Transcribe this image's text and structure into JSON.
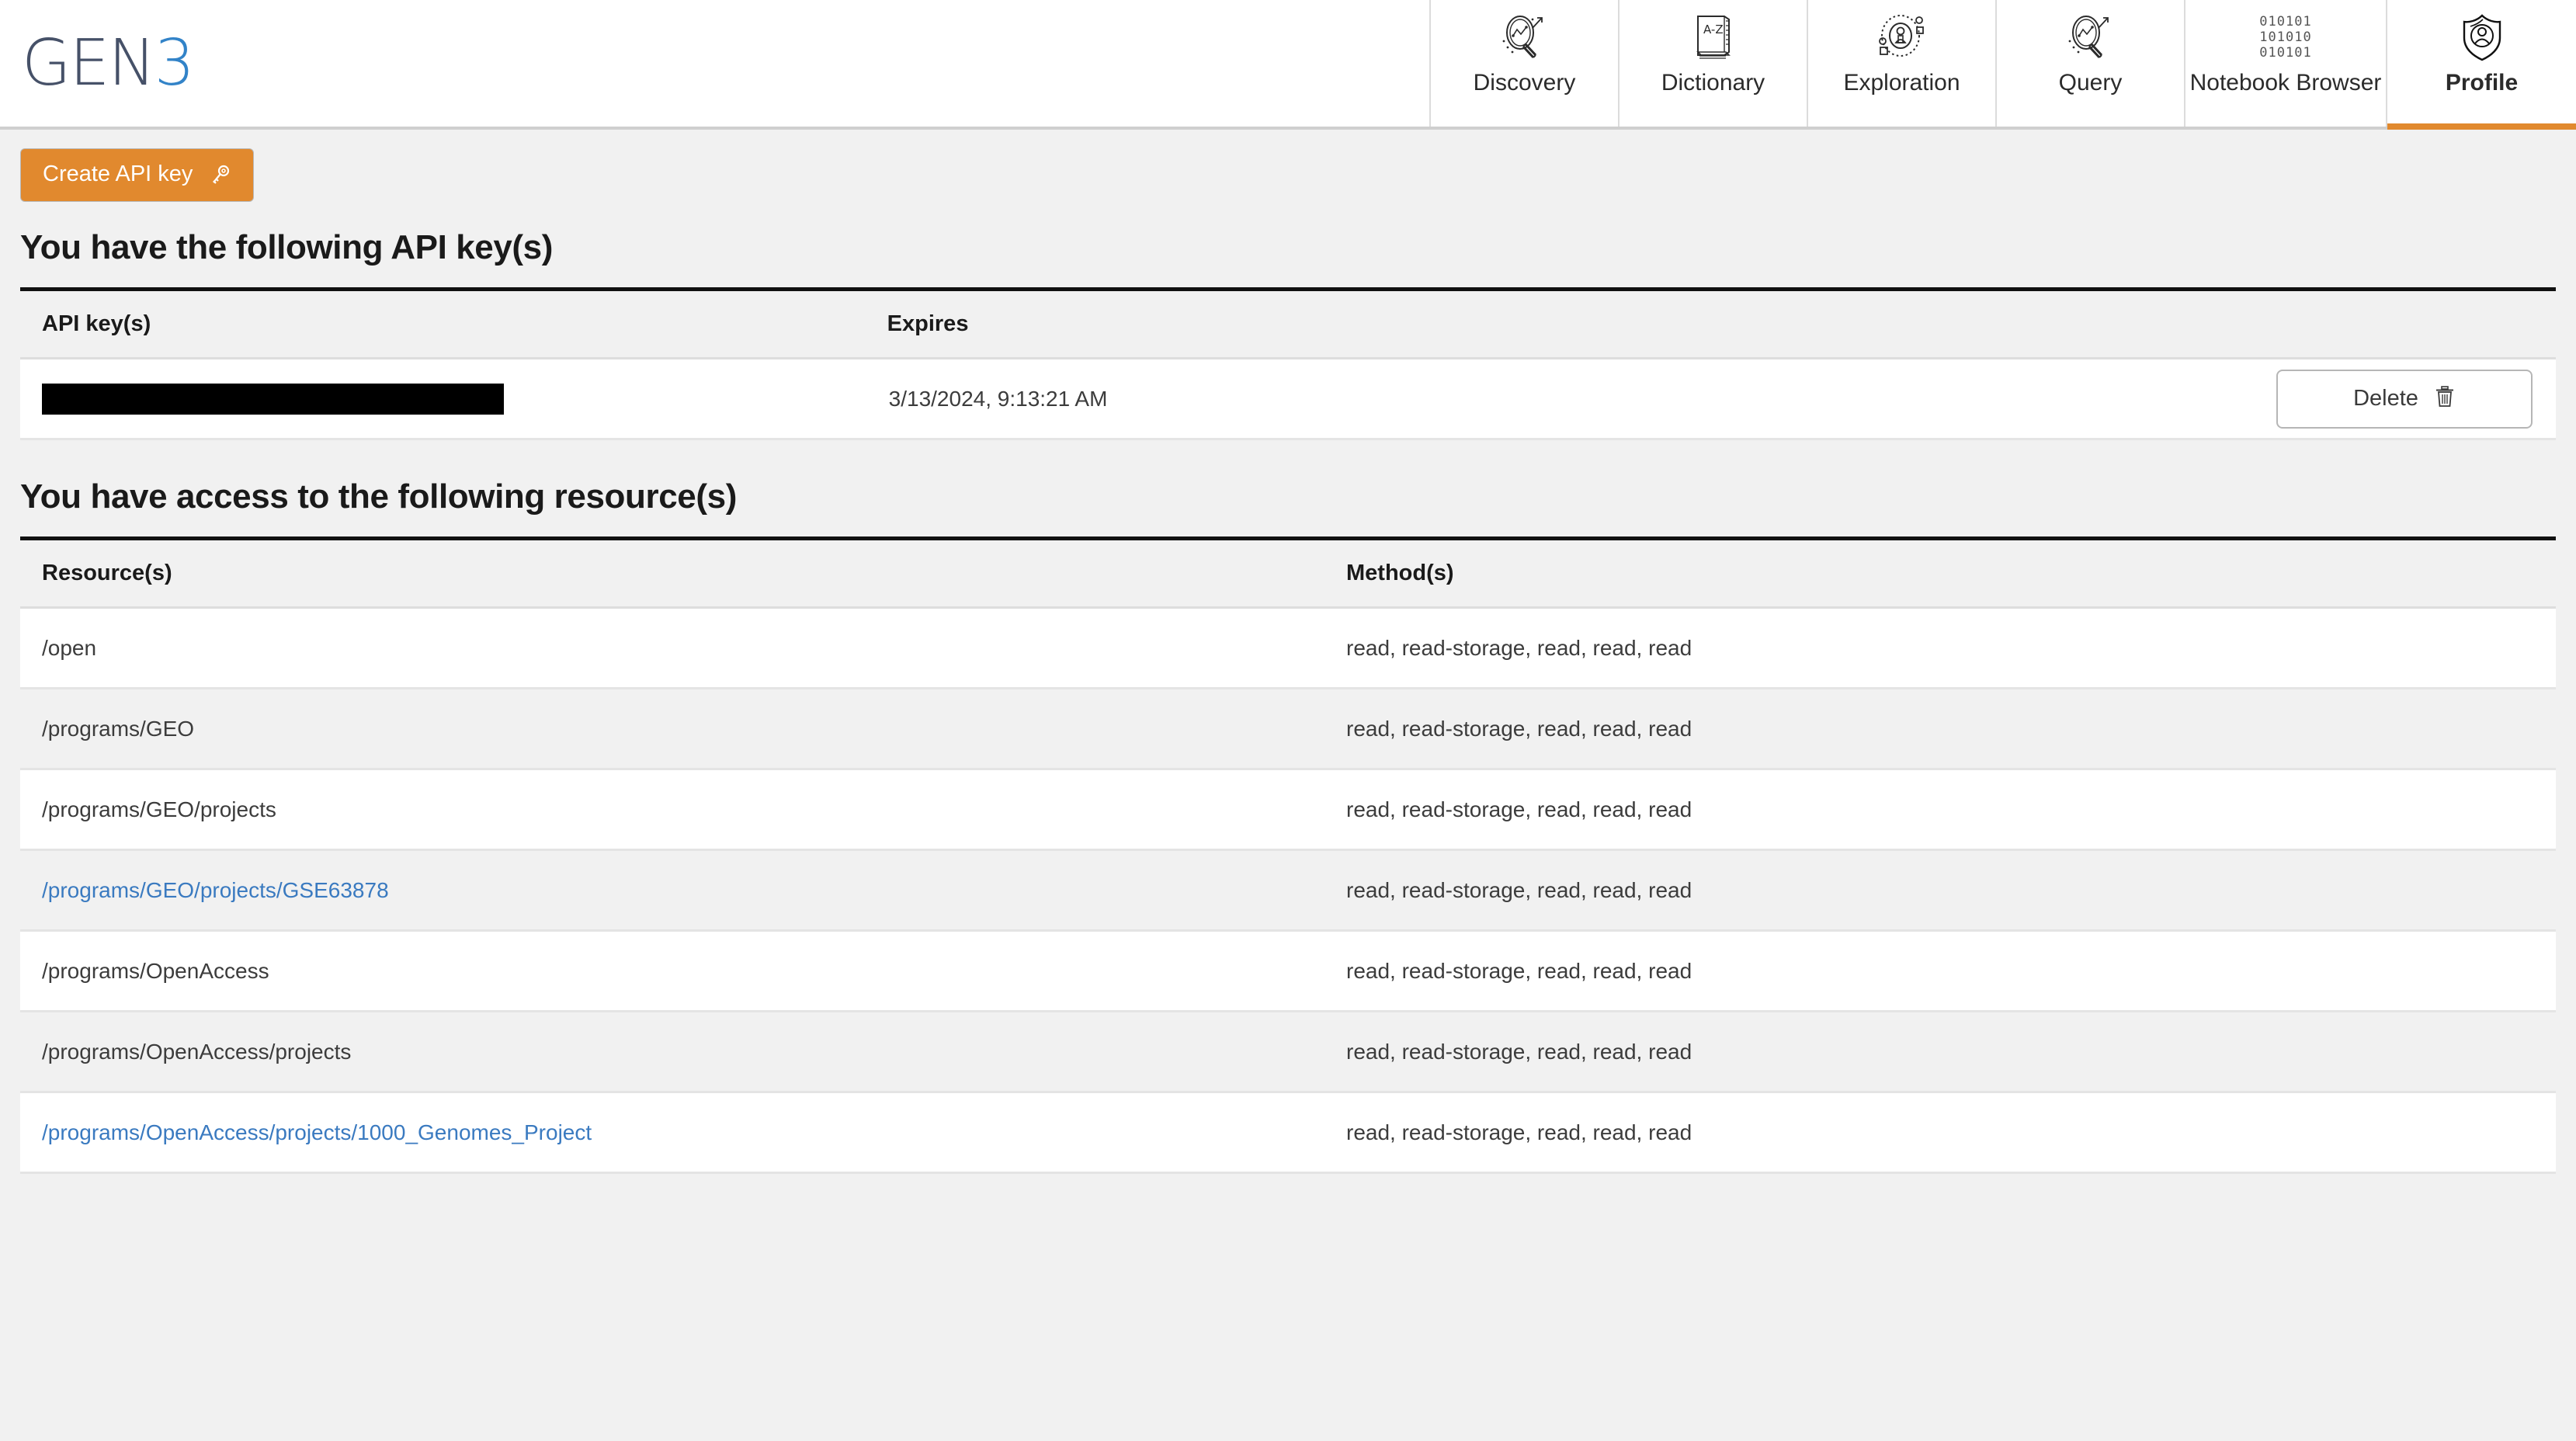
{
  "header": {
    "logo": {
      "primary": "GEN",
      "accent": "3",
      "accent_color": "#3283c8",
      "primary_color": "#465168"
    },
    "nav": [
      {
        "label": "Discovery",
        "icon": "discovery-magnifier-icon",
        "active": false
      },
      {
        "label": "Dictionary",
        "icon": "dictionary-book-icon",
        "active": false
      },
      {
        "label": "Exploration",
        "icon": "exploration-person-orbit-icon",
        "active": false
      },
      {
        "label": "Query",
        "icon": "query-magnifier-icon",
        "active": false
      },
      {
        "label": "Notebook Browser",
        "icon": "notebook-binary-icon",
        "active": false
      },
      {
        "label": "Profile",
        "icon": "profile-shield-person-icon",
        "active": true
      }
    ],
    "active_tab_color": "#e1892e"
  },
  "toolbar": {
    "create_api_key_label": "Create API key",
    "create_api_key_icon": "key-icon",
    "create_api_key_color": "#e1892e"
  },
  "api_keys_section": {
    "heading": "You have the following API key(s)",
    "columns": [
      "API key(s)",
      "Expires",
      ""
    ],
    "rows": [
      {
        "api_key": "",
        "api_key_redacted": true,
        "expires": "3/13/2024, 9:13:21 AM",
        "delete_label": "Delete",
        "delete_icon": "trash-icon"
      }
    ]
  },
  "resources_section": {
    "heading": "You have access to the following resource(s)",
    "columns": [
      "Resource(s)",
      "Method(s)"
    ],
    "link_color": "#3a7ac0",
    "rows": [
      {
        "resource": "/open",
        "methods": "read, read-storage, read, read, read",
        "is_link": false
      },
      {
        "resource": "/programs/GEO",
        "methods": "read, read-storage, read, read, read",
        "is_link": false
      },
      {
        "resource": "/programs/GEO/projects",
        "methods": "read, read-storage, read, read, read",
        "is_link": false
      },
      {
        "resource": "/programs/GEO/projects/GSE63878",
        "methods": "read, read-storage, read, read, read",
        "is_link": true
      },
      {
        "resource": "/programs/OpenAccess",
        "methods": "read, read-storage, read, read, read",
        "is_link": false
      },
      {
        "resource": "/programs/OpenAccess/projects",
        "methods": "read, read-storage, read, read, read",
        "is_link": false
      },
      {
        "resource": "/programs/OpenAccess/projects/1000_Genomes_Project",
        "methods": "read, read-storage, read, read, read",
        "is_link": true
      }
    ]
  }
}
